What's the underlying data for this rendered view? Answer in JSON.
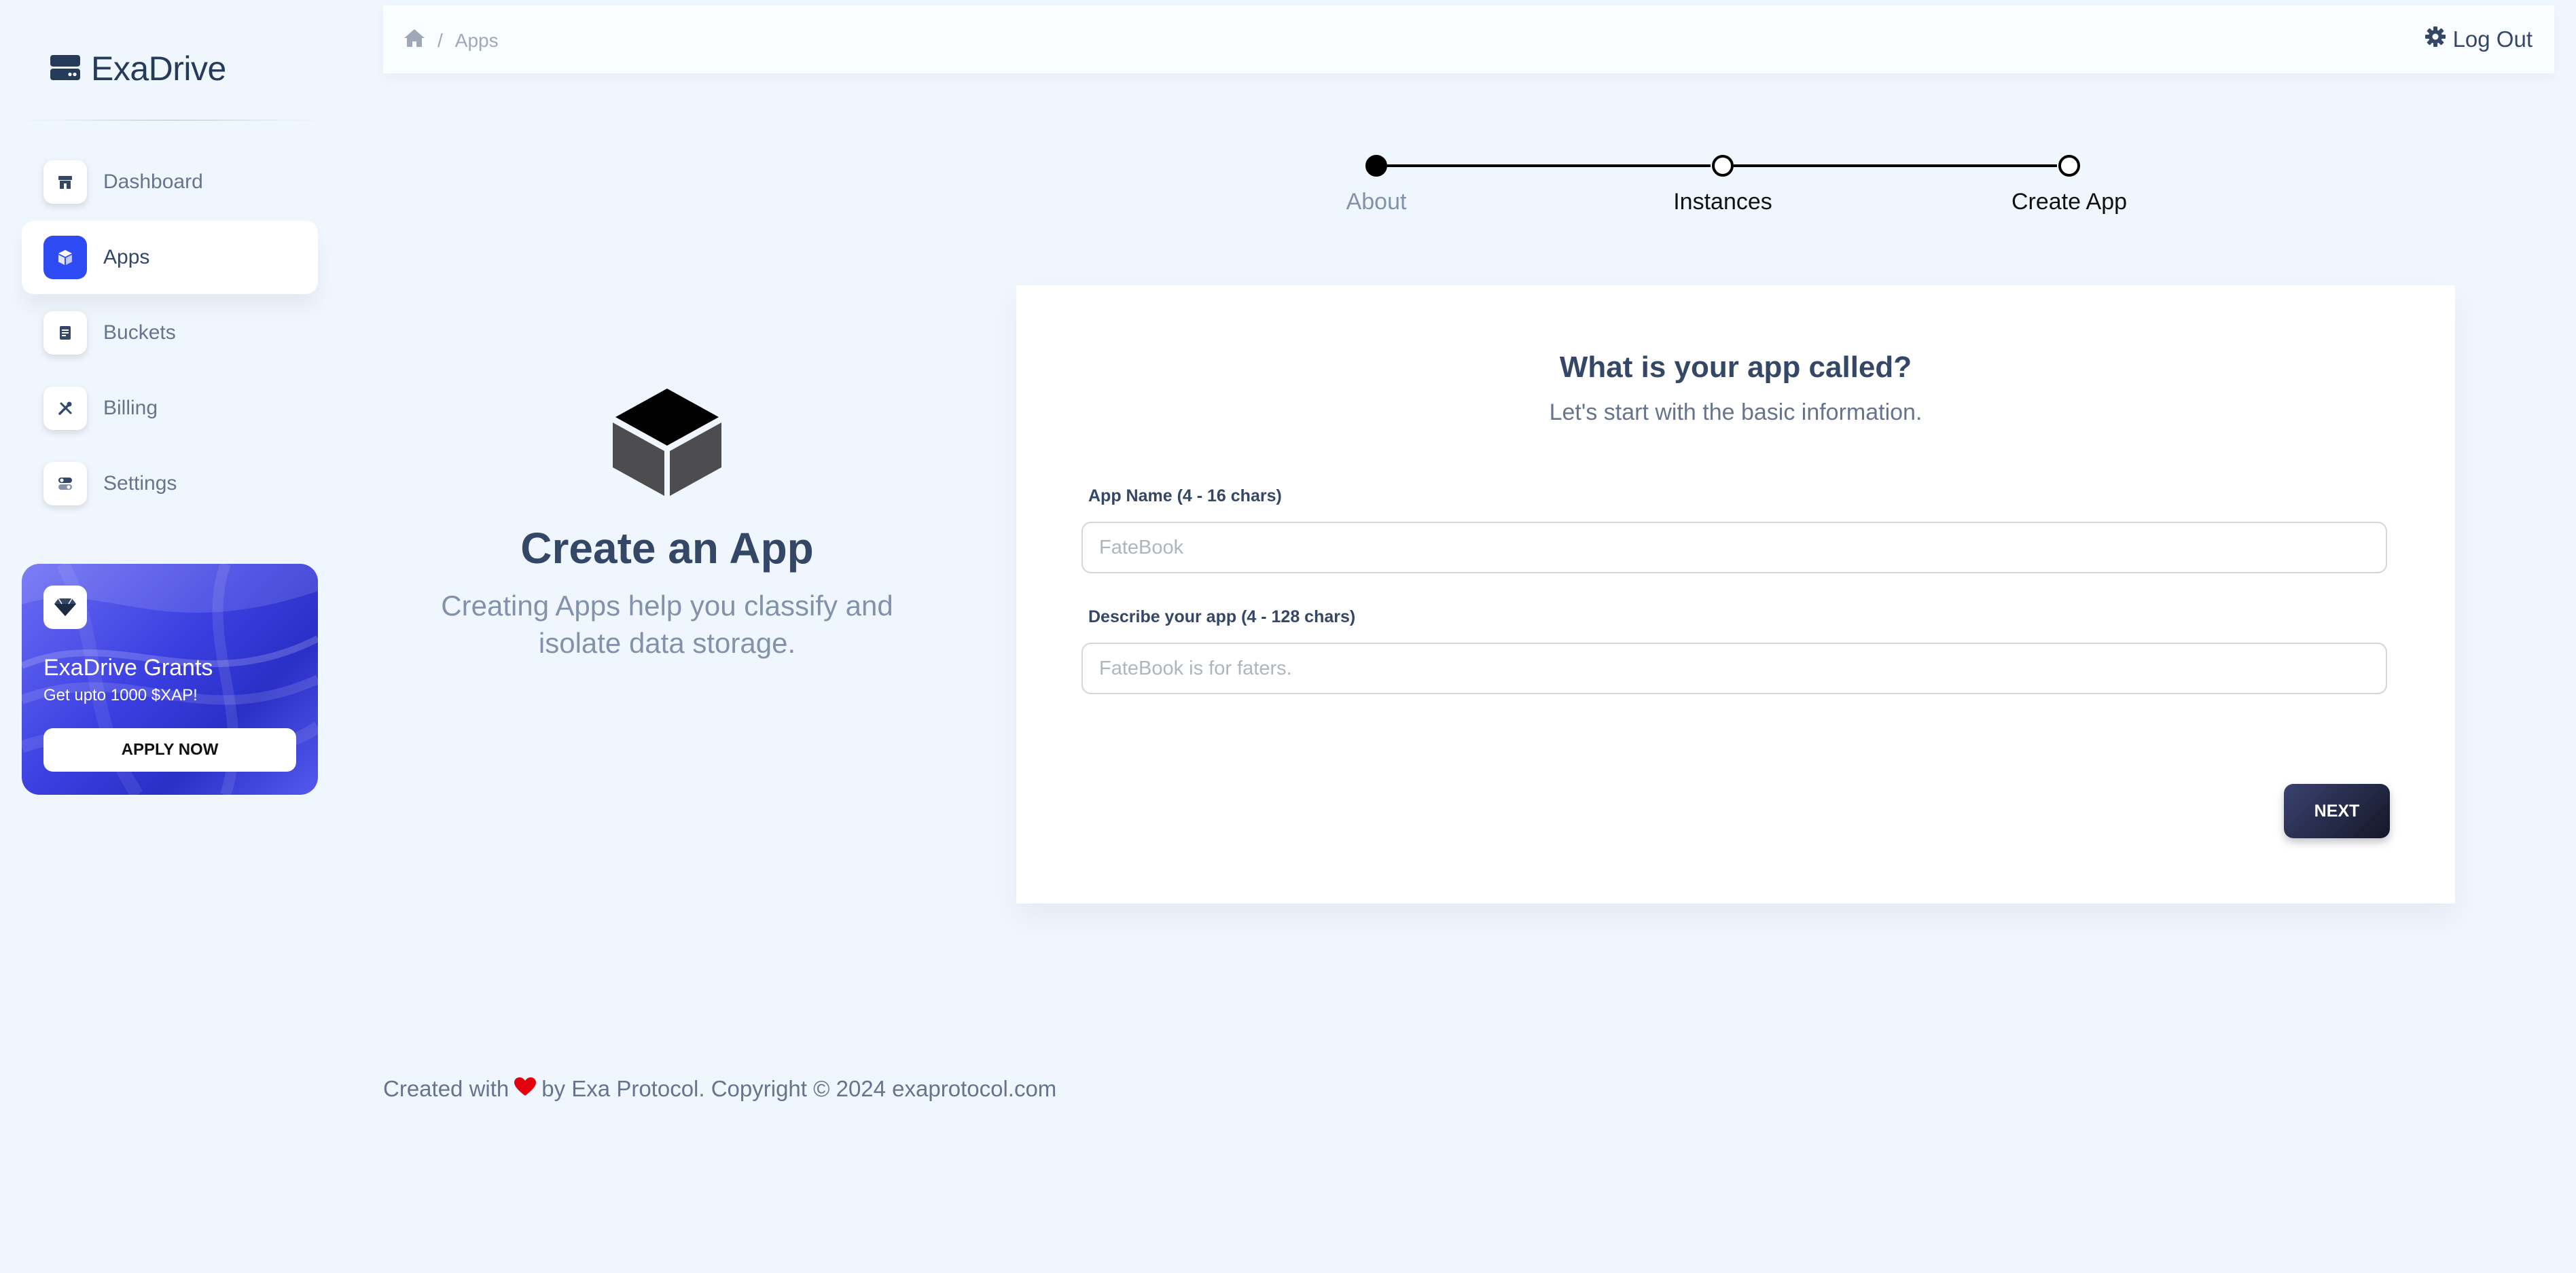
{
  "brand": {
    "name": "ExaDrive"
  },
  "sidebar": {
    "items": [
      {
        "label": "Dashboard",
        "icon": "shop-icon",
        "active": false
      },
      {
        "label": "Apps",
        "icon": "box-icon",
        "active": true
      },
      {
        "label": "Buckets",
        "icon": "document-icon",
        "active": false
      },
      {
        "label": "Billing",
        "icon": "tools-icon",
        "active": false
      },
      {
        "label": "Settings",
        "icon": "toggles-icon",
        "active": false
      }
    ]
  },
  "promo": {
    "title": "ExaDrive Grants",
    "subtitle": "Get upto 1000 $XAP!",
    "button": "APPLY NOW",
    "icon": "diamond-icon"
  },
  "topbar": {
    "breadcrumb": {
      "separator": "/",
      "current": "Apps"
    },
    "logout": "Log Out"
  },
  "stepper": {
    "steps": [
      {
        "label": "About",
        "state": "completed"
      },
      {
        "label": "Instances",
        "state": "pending"
      },
      {
        "label": "Create App",
        "state": "pending"
      }
    ]
  },
  "hero": {
    "title": "Create an App",
    "subtitle": "Creating Apps help you classify and isolate data storage."
  },
  "form": {
    "title": "What is your app called?",
    "subtitle": "Let's start with the basic information.",
    "app_name": {
      "label": "App Name (4 - 16 chars)",
      "value": "",
      "placeholder": "FateBook"
    },
    "description": {
      "label": "Describe your app (4 - 128 chars)",
      "value": "",
      "placeholder": "FateBook is for faters."
    },
    "next": "NEXT"
  },
  "footer": {
    "prefix": "Created with",
    "suffix": "by Exa Protocol. Copyright © 2024 exaprotocol.com"
  },
  "colors": {
    "background": "#eff6fd",
    "primary": "#2e4bf5",
    "text": "#344767",
    "muted": "#8392ab",
    "heart": "#e3000f"
  }
}
